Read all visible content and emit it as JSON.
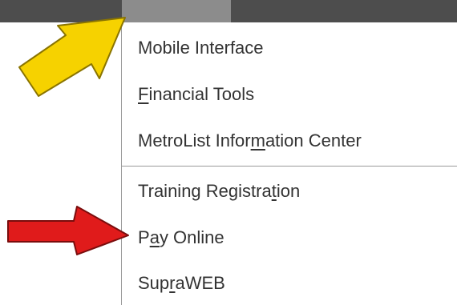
{
  "dropdown": {
    "items": [
      {
        "id": "mobile",
        "before": "Mobile Interface",
        "mnemonic": "",
        "after": ""
      },
      {
        "id": "financial",
        "before": "",
        "mnemonic": "F",
        "after": "inancial Tools"
      },
      {
        "id": "metrolist",
        "before": "MetroList Infor",
        "mnemonic": "m",
        "after": "ation Center"
      },
      {
        "id": "training",
        "before": "Training Registra",
        "mnemonic": "t",
        "after": "ion"
      },
      {
        "id": "pay",
        "before": "P",
        "mnemonic": "a",
        "after": "y Online"
      },
      {
        "id": "supra",
        "before": "Sup",
        "mnemonic": "r",
        "after": "aWEB"
      }
    ]
  },
  "annotations": {
    "yellow_arrow_color": "#f6d200",
    "red_arrow_color": "#e01b1b",
    "menubar_color": "#4d4d4d",
    "active_tab_color": "#8c8c8c"
  }
}
